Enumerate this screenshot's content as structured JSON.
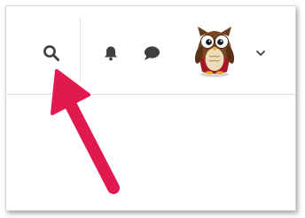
{
  "header": {
    "icons": {
      "search": "search-icon",
      "notifications": "bell-icon",
      "messages": "chat-icon",
      "profile": "owl-avatar",
      "menu": "chevron-down-icon"
    }
  },
  "annotation": {
    "arrow_color": "#e0194f",
    "points_to": "search-icon"
  },
  "colors": {
    "icon": "#3f3f3f",
    "divider": "#dedede"
  }
}
